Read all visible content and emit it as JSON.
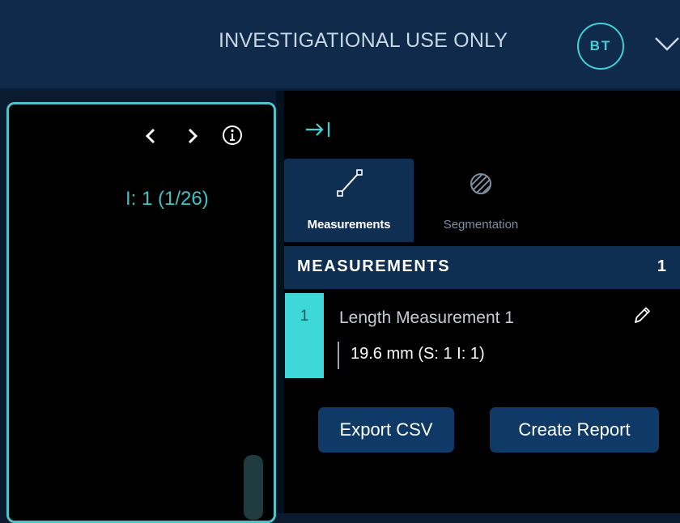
{
  "header": {
    "banner": "INVESTIGATIONAL USE ONLY",
    "avatar_initials": "BT",
    "menu_icon": "chevron-down-icon"
  },
  "viewport": {
    "series_label": "I: 1 (1/26)",
    "icons": [
      "chevron-left-icon",
      "chevron-right-icon",
      "info-icon"
    ],
    "border_color": "#4fc3c9"
  },
  "side_panel": {
    "collapse_icon": "collapse-right-icon",
    "tabs": [
      {
        "label": "Measurements",
        "icon": "measurement-line-icon",
        "active": true
      },
      {
        "label": "Segmentation",
        "icon": "segmentation-hatch-icon",
        "active": false
      }
    ],
    "measurements": {
      "title": "MEASUREMENTS",
      "count": "1",
      "items": [
        {
          "index": "1",
          "label": "Length Measurement 1",
          "value": "19.6 mm (S: 1 I: 1)"
        }
      ]
    },
    "actions": {
      "export_label": "Export CSV",
      "report_label": "Create Report"
    }
  },
  "colors": {
    "accent": "#3fd0d8",
    "header_bg": "#0f2a4b",
    "button_bg": "#0f3966"
  }
}
